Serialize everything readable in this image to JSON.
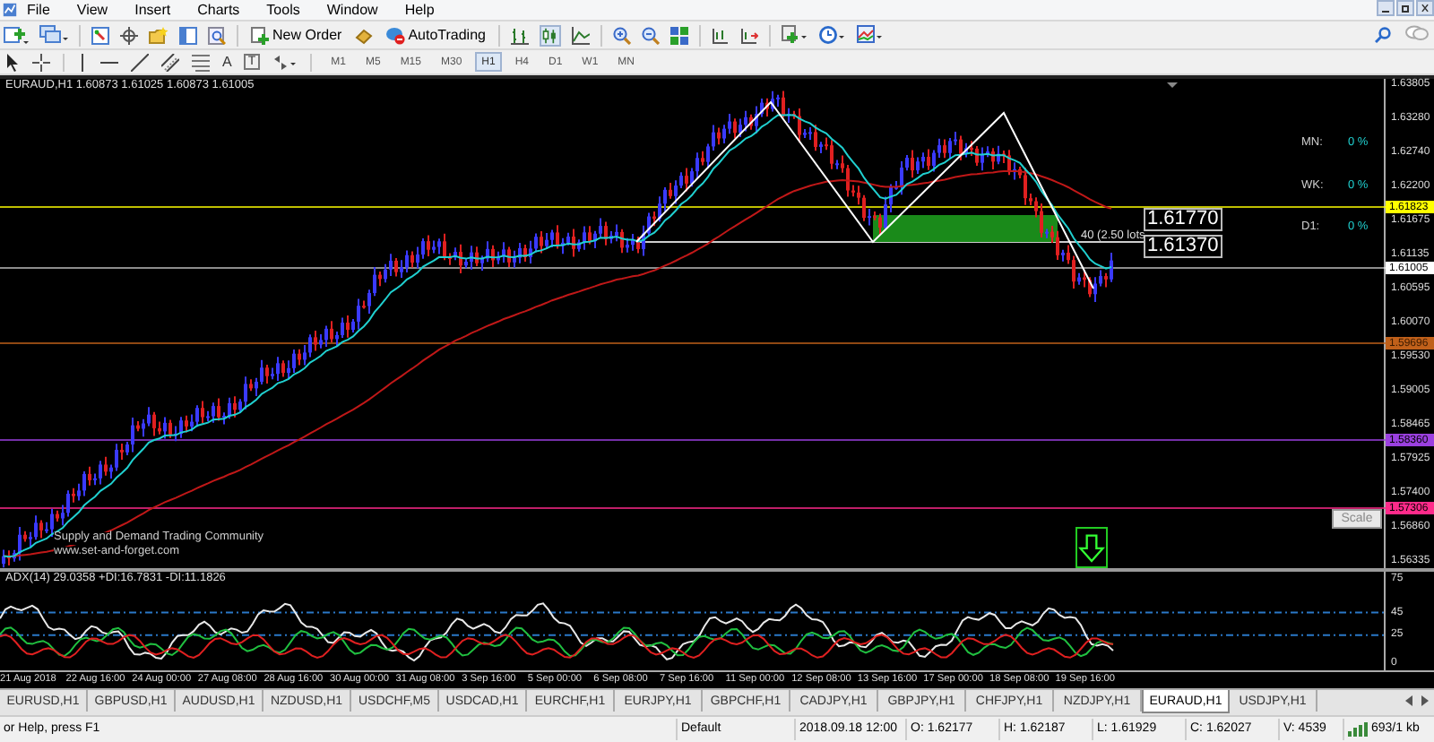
{
  "menu": [
    "File",
    "View",
    "Insert",
    "Charts",
    "Tools",
    "Window",
    "Help"
  ],
  "toolbar": {
    "new_order": "New Order",
    "autotrading": "AutoTrading",
    "text_tool": "A",
    "label_tool": "T"
  },
  "timeframes": [
    {
      "label": "M1",
      "selected": false
    },
    {
      "label": "M5",
      "selected": false
    },
    {
      "label": "M15",
      "selected": false
    },
    {
      "label": "M30",
      "selected": false
    },
    {
      "label": "H1",
      "selected": true
    },
    {
      "label": "H4",
      "selected": false
    },
    {
      "label": "D1",
      "selected": false
    },
    {
      "label": "W1",
      "selected": false
    },
    {
      "label": "MN",
      "selected": false
    }
  ],
  "chart": {
    "symbol": "EURAUD,H1",
    "ohlc": "1.60873 1.61025 1.60873 1.61005",
    "price_axis": [
      "1.63805",
      "1.63280",
      "1.62740",
      "1.62200",
      "1.61675",
      "1.61135",
      "1.60595",
      "1.60070",
      "1.59530",
      "1.59005",
      "1.58465",
      "1.57925",
      "1.57400",
      "1.56860",
      "1.56335"
    ],
    "price_markers": [
      {
        "label": "1.61823",
        "color": "#ffff00"
      },
      {
        "label": "1.61005",
        "color": "#ffffff"
      },
      {
        "label": "1.59696",
        "color": "#c0601a"
      },
      {
        "label": "1.58360",
        "color": "#9b40e0"
      },
      {
        "label": "1.57306",
        "color": "#ff2a8a"
      }
    ],
    "periods": [
      {
        "label": "MN:",
        "value": "0 %"
      },
      {
        "label": "WK:",
        "value": "0 %"
      },
      {
        "label": "D1:",
        "value": "0 %"
      }
    ],
    "price_boxes": [
      "1.61770",
      "1.61370"
    ],
    "zone_label": "40 (2.50 lots",
    "branding": [
      "Supply and Demand Trading Community",
      "www.set-and-forget.com"
    ],
    "scale_button": "Scale"
  },
  "indicator": {
    "label": "ADX(14) 29.0358 +DI:16.7831 -DI:11.1826",
    "axis": [
      "75",
      "45",
      "25",
      "0"
    ]
  },
  "time_axis": [
    "21 Aug 2018",
    "22 Aug 16:00",
    "24 Aug 00:00",
    "27 Aug 08:00",
    "28 Aug 16:00",
    "30 Aug 00:00",
    "31 Aug 08:00",
    "3 Sep 16:00",
    "5 Sep 00:00",
    "6 Sep 08:00",
    "7 Sep 16:00",
    "11 Sep 00:00",
    "12 Sep 08:00",
    "13 Sep 16:00",
    "17 Sep 00:00",
    "18 Sep 08:00",
    "19 Sep 16:00"
  ],
  "tabs": [
    {
      "label": "EURUSD,H1",
      "selected": false
    },
    {
      "label": "GBPUSD,H1",
      "selected": false
    },
    {
      "label": "AUDUSD,H1",
      "selected": false
    },
    {
      "label": "NZDUSD,H1",
      "selected": false
    },
    {
      "label": "USDCHF,M5",
      "selected": false
    },
    {
      "label": "USDCAD,H1",
      "selected": false
    },
    {
      "label": "EURCHF,H1",
      "selected": false
    },
    {
      "label": "EURJPY,H1",
      "selected": false
    },
    {
      "label": "GBPCHF,H1",
      "selected": false
    },
    {
      "label": "CADJPY,H1",
      "selected": false
    },
    {
      "label": "GBPJPY,H1",
      "selected": false
    },
    {
      "label": "CHFJPY,H1",
      "selected": false
    },
    {
      "label": "NZDJPY,H1",
      "selected": false
    },
    {
      "label": "EURAUD,H1",
      "selected": true
    },
    {
      "label": "USDJPY,H1",
      "selected": false
    }
  ],
  "status_bar": {
    "help": "or Help, press F1",
    "profile": "Default",
    "time": "2018.09.18 12:00",
    "open": "O: 1.62177",
    "high": "H: 1.62187",
    "low": "L: 1.61929",
    "close": "C: 1.62027",
    "volume": "V: 4539",
    "traffic": "693/1 kb"
  }
}
